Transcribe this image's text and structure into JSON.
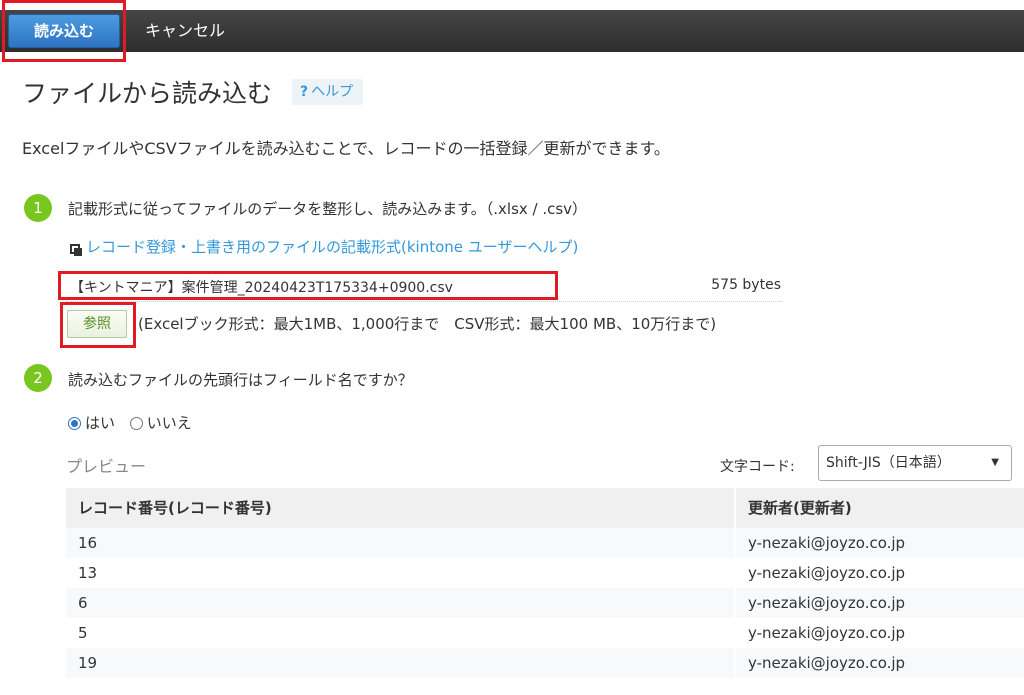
{
  "toolbar": {
    "load_label": "読み込む",
    "cancel_label": "キャンセル"
  },
  "header": {
    "title": "ファイルから読み込む",
    "help_icon": "?",
    "help_label": "ヘルプ"
  },
  "description": "ExcelファイルやCSVファイルを読み込むことで、レコードの一括登録／更新ができます。",
  "step1": {
    "number": "1",
    "text": "記載形式に従ってファイルのデータを整形し、読み込みます。（.xlsx / .csv）",
    "format_link": "レコード登録・上書き用のファイルの記載形式(kintone ユーザーヘルプ)",
    "file_name": "【キントマニア】案件管理_20240423T175334+0900.csv",
    "file_size": "575 bytes",
    "browse_label": "参照",
    "limits": "(Excelブック形式：最大1MB、1,000行まで　CSV形式：最大100 MB、10万行まで)"
  },
  "step2": {
    "number": "2",
    "text": "読み込むファイルの先頭行はフィールド名ですか？",
    "options": [
      {
        "label": "はい",
        "selected": true
      },
      {
        "label": "いいえ",
        "selected": false
      }
    ]
  },
  "preview": {
    "label": "プレビュー",
    "encoding_label": "文字コード:",
    "encoding_value": "Shift-JIS（日本語）",
    "columns": [
      "レコード番号(レコード番号)",
      "更新者(更新者)"
    ],
    "rows": [
      [
        "16",
        "y-nezaki@joyzo.co.jp"
      ],
      [
        "13",
        "y-nezaki@joyzo.co.jp"
      ],
      [
        "6",
        "y-nezaki@joyzo.co.jp"
      ],
      [
        "5",
        "y-nezaki@joyzo.co.jp"
      ],
      [
        "19",
        "y-nezaki@joyzo.co.jp"
      ]
    ]
  },
  "colors": {
    "accent": "#3498db",
    "step": "#79c61f",
    "highlight": "#e01b24",
    "primary_button": "#2d73c2"
  },
  "icons": {
    "external_link": "external-link-icon",
    "dropdown": "chevron-down-icon"
  }
}
